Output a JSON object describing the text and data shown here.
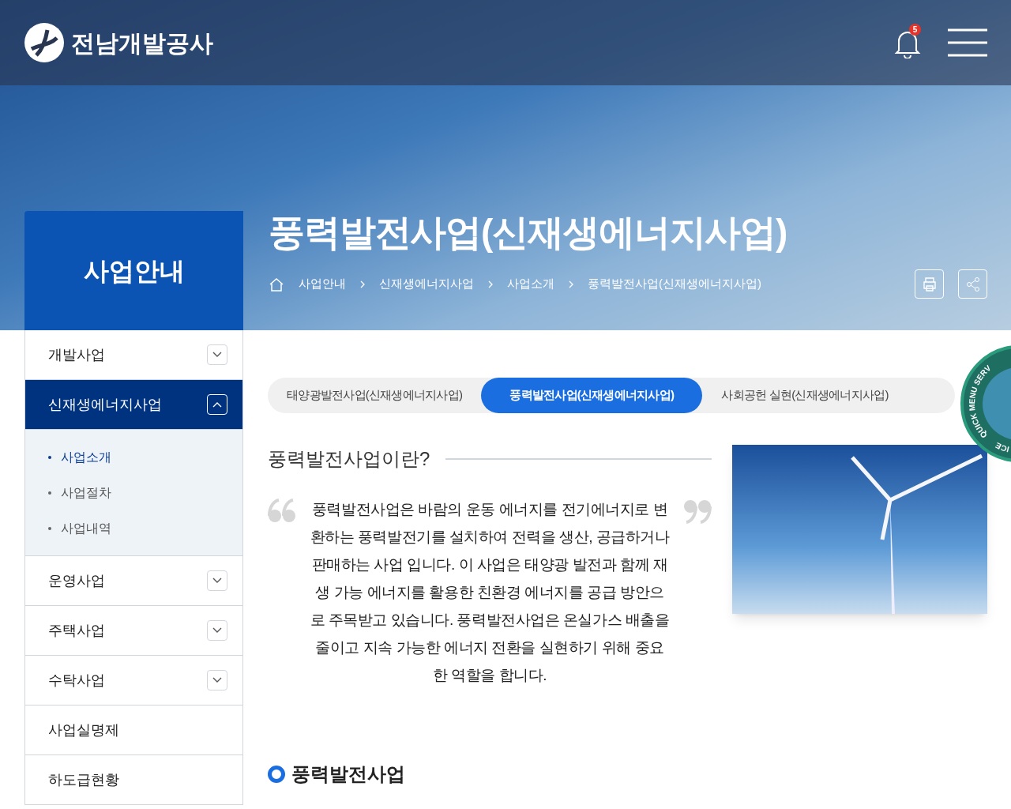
{
  "header": {
    "logo_text": "전남개발공사",
    "notification_count": "5"
  },
  "hero": {
    "section_title": "사업안내",
    "page_title": "풍력발전사업(신재생에너지사업)",
    "breadcrumb": [
      "사업안내",
      "신재생에너지사업",
      "사업소개",
      "풍력발전사업(신재생에너지사업)"
    ]
  },
  "sidebar": {
    "items": [
      {
        "label": "개발사업",
        "expandable": true,
        "expanded": false,
        "selected": false
      },
      {
        "label": "신재생에너지사업",
        "expandable": true,
        "expanded": true,
        "selected": true,
        "children": [
          {
            "label": "사업소개",
            "selected": true
          },
          {
            "label": "사업절차",
            "selected": false
          },
          {
            "label": "사업내역",
            "selected": false
          }
        ]
      },
      {
        "label": "운영사업",
        "expandable": true,
        "expanded": false,
        "selected": false
      },
      {
        "label": "주택사업",
        "expandable": true,
        "expanded": false,
        "selected": false
      },
      {
        "label": "수탁사업",
        "expandable": true,
        "expanded": false,
        "selected": false
      },
      {
        "label": "사업실명제",
        "expandable": false,
        "selected": false
      },
      {
        "label": "하도급현황",
        "expandable": false,
        "selected": false
      }
    ]
  },
  "tabs": [
    {
      "label": "태양광발전사업(신재생에너지사업)",
      "selected": false
    },
    {
      "label": "풍력발전사업(신재생에너지사업)",
      "selected": true
    },
    {
      "label": "사회공헌 실현(신재생에너지사업)",
      "selected": false
    }
  ],
  "intro": {
    "heading": "풍력발전사업이란?",
    "text": "풍력발전사업은 바람의 운동 에너지를 전기에너지로 변환하는 풍력발전기를 설치하여 전력을 생산, 공급하거나 판매하는 사업 입니다. 이 사업은 태양광 발전과 함께 재생 가능 에너지를 활용한 친환경 에너지를 공급 방안으로 주목받고 있습니다. 풍력발전사업은 온실가스 배출을 줄이고 지속 가능한 에너지 전환을 실현하기 위해 중요한 역할을 합니다."
  },
  "section_heading": "풍력발전사업",
  "quick_menu": {
    "label_top": "QUICK MENU SERV",
    "label_bottom": "ICE"
  }
}
